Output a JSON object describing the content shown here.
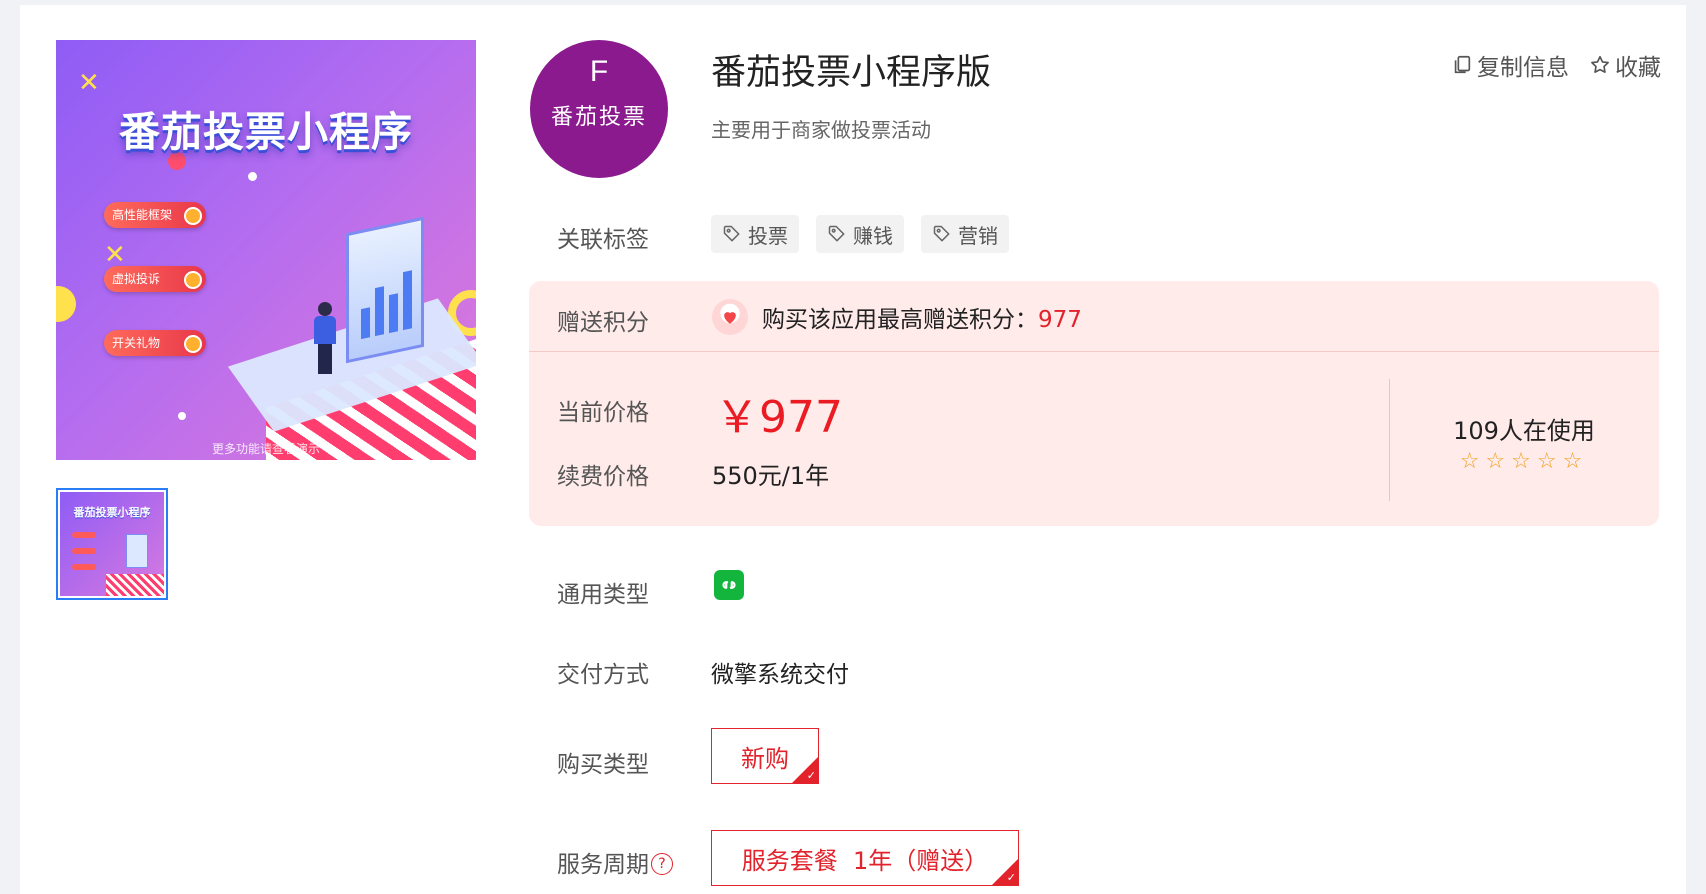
{
  "product": {
    "logo_letter": "F",
    "logo_text": "番茄投票",
    "title": "番茄投票小程序版",
    "subtitle": "主要用于商家做投票活动"
  },
  "gallery": {
    "poster_title": "番茄投票小程序",
    "poster_features": [
      "高性能框架",
      "虚拟投诉",
      "开关礼物"
    ],
    "poster_footer": "更多功能请查看演示",
    "thumb_title": "番茄投票小程序"
  },
  "actions": {
    "copy_label": "复制信息",
    "favorite_label": "收藏"
  },
  "labels": {
    "tags": "关联标签",
    "points": "赠送积分",
    "current_price": "当前价格",
    "renew_price": "续费价格",
    "general_type": "通用类型",
    "delivery": "交付方式",
    "purchase_type": "购买类型",
    "service_period": "服务周期"
  },
  "tags": [
    "投票",
    "赚钱",
    "营销"
  ],
  "points": {
    "text": "购买该应用最高赠送积分：",
    "value": "977"
  },
  "pricing": {
    "current": "￥977",
    "renew": "550元/1年",
    "users": "109人在使用",
    "stars": "☆☆☆☆☆"
  },
  "delivery_value": "微擎系统交付",
  "purchase_option": "新购",
  "service_option": "服务套餐  1年（赠送）",
  "help_glyph": "?",
  "check_glyph": "✓",
  "colors": {
    "accent_red": "#e3232c",
    "price_bg": "#ffebea",
    "logo_purple": "#8a1a8e",
    "miniprogram_green": "#13b53d"
  },
  "icons": [
    "copy-icon",
    "star-icon",
    "tag-icon",
    "gem-icon",
    "miniprogram-icon",
    "help-icon"
  ]
}
